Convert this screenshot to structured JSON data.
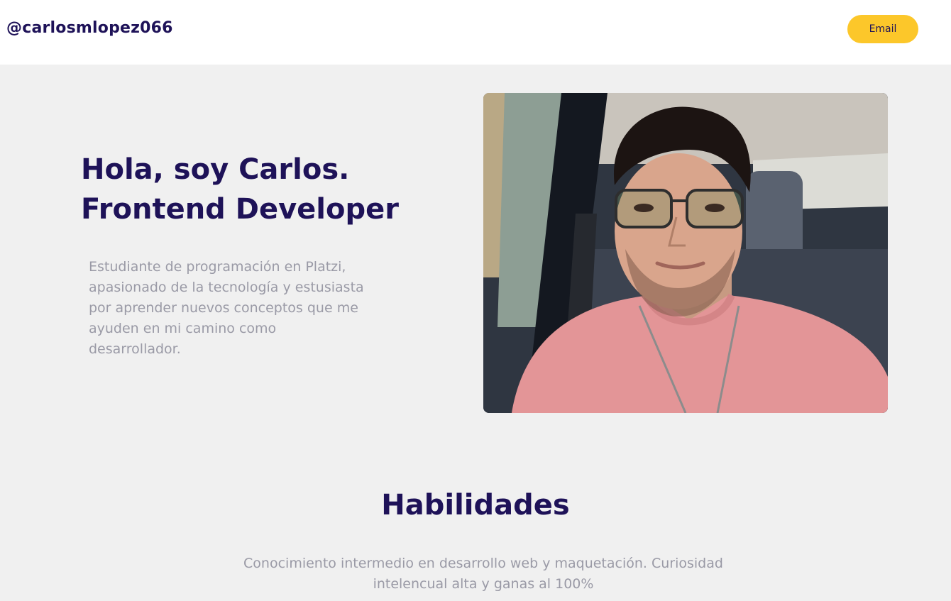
{
  "header": {
    "handle": "@carlosmlopez066",
    "email_label": "Email"
  },
  "hero": {
    "title_line1": "Hola, soy Carlos.",
    "title_line2": "Frontend Developer",
    "description": "Estudiante de programación en Platzi, apasionado de la tecnología y estusiasta por aprender nuevos conceptos que me ayuden en mi camino como desarrollador.",
    "photo_icon": "profile-photo"
  },
  "skills": {
    "title": "Habilidades",
    "description": "Conocimiento intermedio en desarrollo web y maquetación. Curiosidad intelencual alta y ganas al 100%"
  },
  "colors": {
    "navy": "#1e1258",
    "accent": "#fcc72a",
    "muted_text": "#9a9aa6",
    "background": "#f0f0f0"
  }
}
